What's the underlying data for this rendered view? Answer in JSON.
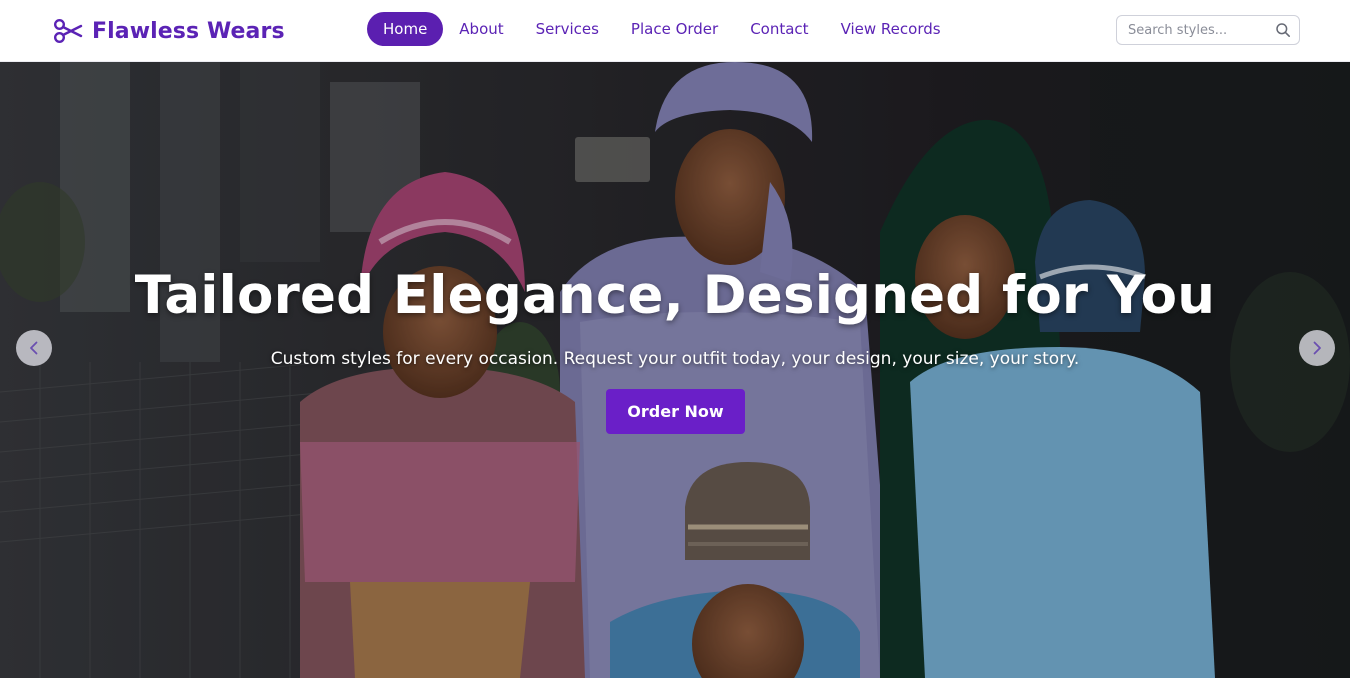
{
  "brand": {
    "name": "Flawless Wears",
    "icon": "scissors-icon",
    "color": "#5b23b5"
  },
  "nav": {
    "items": [
      {
        "label": "Home",
        "active": true
      },
      {
        "label": "About",
        "active": false
      },
      {
        "label": "Services",
        "active": false
      },
      {
        "label": "Place Order",
        "active": false
      },
      {
        "label": "Contact",
        "active": false
      },
      {
        "label": "View Records",
        "active": false
      }
    ],
    "active_color": "#5b1fb0"
  },
  "search": {
    "placeholder": "Search styles...",
    "value": "",
    "icon": "search-icon"
  },
  "hero": {
    "title": "Tailored Elegance, Designed for You",
    "subtitle": "Custom styles for every occasion. Request your outfit today, your design, your size, your story.",
    "cta_label": "Order Now",
    "cta_color": "#6a1fc8",
    "prev_icon": "chevron-left-icon",
    "next_icon": "chevron-right-icon"
  }
}
